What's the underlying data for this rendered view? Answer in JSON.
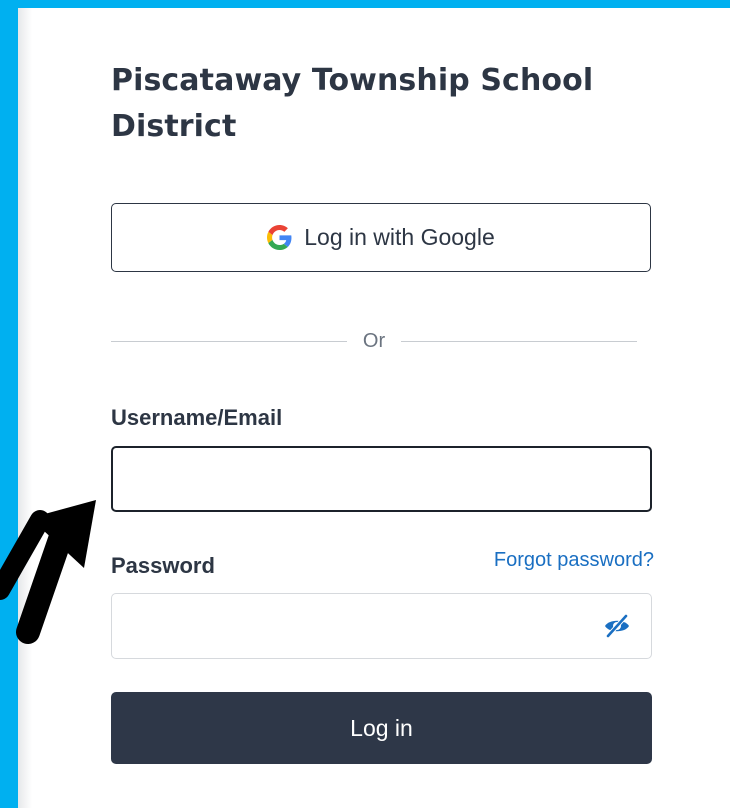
{
  "brand": {
    "background_color": "#00b0f0",
    "text_color": "#2d3644",
    "link_color": "#1a6fc2",
    "primary_button_color": "#2e3748"
  },
  "login": {
    "title": "Piscataway Township School District",
    "google_button": {
      "label": "Log in with Google",
      "icon": "google-g-icon"
    },
    "divider_text": "Or",
    "username": {
      "label": "Username/Email",
      "value": "",
      "placeholder": ""
    },
    "password": {
      "label": "Password",
      "value": "",
      "placeholder": "",
      "forgot_link": "Forgot password?",
      "toggle_icon": "eye-slash-icon"
    },
    "submit_label": "Log in"
  },
  "annotation": {
    "icon": "pointing-arrow"
  }
}
